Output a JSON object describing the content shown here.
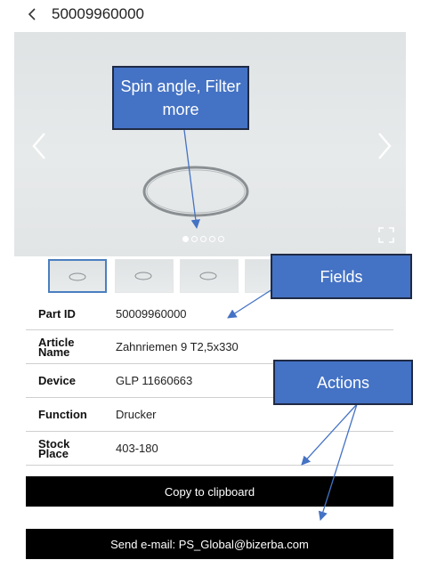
{
  "header": {
    "title": "50009960000"
  },
  "gallery": {
    "dot_count": 5,
    "active_dot": 0,
    "thumb_count": 4,
    "active_thumb": 0
  },
  "fields": [
    {
      "label": "Part ID",
      "value": "50009960000"
    },
    {
      "label": "Article Name",
      "value": "Zahnriemen 9 T2,5x330"
    },
    {
      "label": "Device",
      "value": "GLP 11660663"
    },
    {
      "label": "Function",
      "value": "Drucker"
    },
    {
      "label": "Stock Place",
      "value": "403-180"
    }
  ],
  "actions": {
    "copy_label": "Copy to clipboard",
    "email_label": "Send e-mail: PS_Global@bizerba.com"
  },
  "callouts": {
    "spin": "Spin angle, Filter more",
    "fields": "Fields",
    "actions": "Actions"
  },
  "colors": {
    "callout": "#4472c4",
    "button": "#000000",
    "thumb_active_border": "#4a7fc0"
  }
}
